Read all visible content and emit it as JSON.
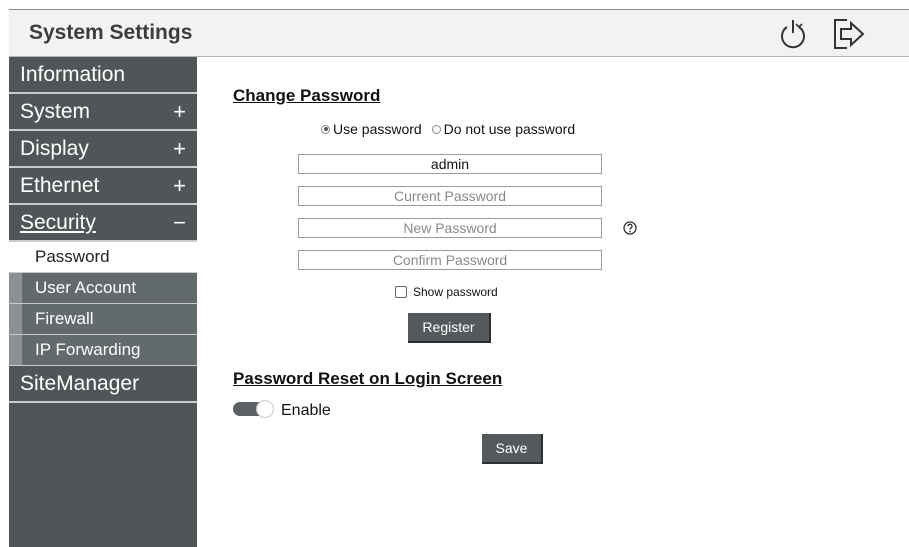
{
  "header": {
    "title": "System Settings",
    "icons": [
      "power-icon",
      "logout-icon"
    ]
  },
  "sidebar": {
    "items": [
      {
        "label": "Information",
        "sign": ""
      },
      {
        "label": "System",
        "sign": "+"
      },
      {
        "label": "Display",
        "sign": "+"
      },
      {
        "label": "Ethernet",
        "sign": "+"
      },
      {
        "label": "Security",
        "sign": "−"
      }
    ],
    "security_sub": [
      {
        "label": "Password",
        "selected": true
      },
      {
        "label": "User Account"
      },
      {
        "label": "Firewall"
      },
      {
        "label": "IP Forwarding"
      }
    ],
    "tail_item": "SiteManager"
  },
  "change_password": {
    "title": "Change Password",
    "radio_use": "Use password",
    "radio_no": "Do not use password",
    "selected_radio": "Use password",
    "username_value": "admin",
    "current_placeholder": "Current Password",
    "new_placeholder": "New Password",
    "confirm_placeholder": "Confirm Password",
    "show_password_label": "Show password",
    "show_password_checked": false,
    "register_label": "Register"
  },
  "password_reset": {
    "title": "Password Reset on Login Screen",
    "enable_label": "Enable",
    "enabled": true,
    "save_label": "Save"
  },
  "colors": {
    "sidebar_bg": "#505658",
    "header_bg": "#f2f2f2",
    "button_bg": "#545a5c"
  }
}
